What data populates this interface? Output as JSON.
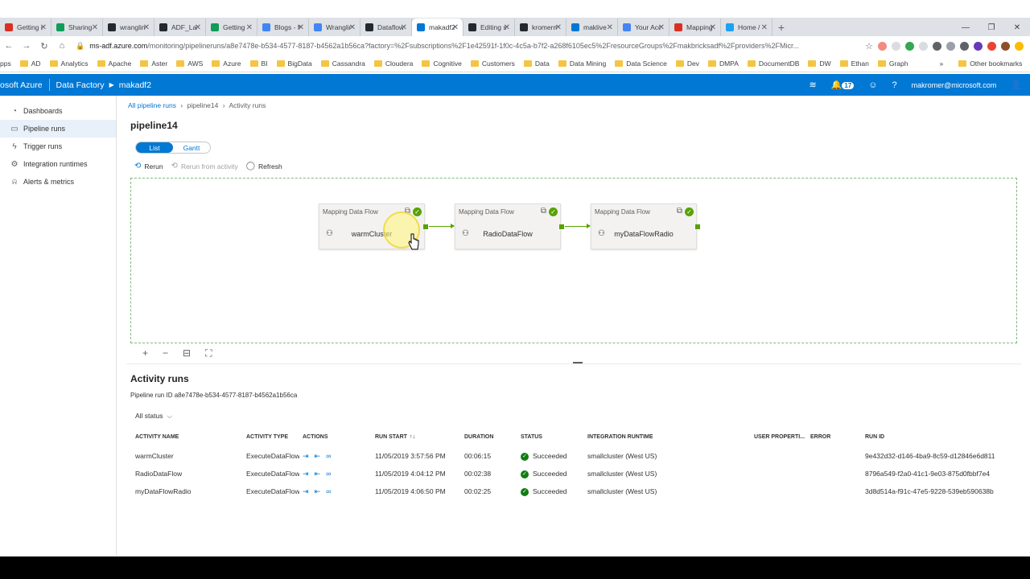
{
  "browser": {
    "tabs": [
      {
        "label": "Getting s",
        "color": "#d93025",
        "active": false
      },
      {
        "label": "Sharing",
        "color": "#0f9d58",
        "active": false
      },
      {
        "label": "wranglin",
        "color": "#24292e",
        "active": false
      },
      {
        "label": "ADF_Lab",
        "color": "#24292e",
        "active": false
      },
      {
        "label": "Getting",
        "color": "#0f9d58",
        "active": false
      },
      {
        "label": "Blogs - M",
        "color": "#4285f4",
        "active": false
      },
      {
        "label": "Wranglin",
        "color": "#4285f4",
        "active": false
      },
      {
        "label": "Dataflow",
        "color": "#24292e",
        "active": false
      },
      {
        "label": "makadf2",
        "color": "#0078d4",
        "active": true
      },
      {
        "label": "Editing s",
        "color": "#24292e",
        "active": false
      },
      {
        "label": "kromerm",
        "color": "#24292e",
        "active": false
      },
      {
        "label": "maklive",
        "color": "#0078d4",
        "active": false
      },
      {
        "label": "Your Acc",
        "color": "#4285f4",
        "active": false
      },
      {
        "label": "Mapping",
        "color": "#d93025",
        "active": false
      },
      {
        "label": "Home /",
        "color": "#1da1f2",
        "active": false
      }
    ],
    "new_tab": "+",
    "url_host": "ms-adf.azure.com",
    "url_path": "/monitoring/pipelineruns/a8e7478e-b534-4577-8187-b4562a1b56ca?factory=%2Fsubscriptions%2F1e42591f-1f0c-4c5a-b7f2-a268f6105ec5%2FresourceGroups%2Fmakbricksadf%2Fproviders%2FMicr...",
    "bookmarks": [
      "pps",
      "AD",
      "Analytics",
      "Apache",
      "Aster",
      "AWS",
      "Azure",
      "BI",
      "BigData",
      "Cassandra",
      "Cloudera",
      "Cognitive",
      "Customers",
      "Data",
      "Data Mining",
      "Data Science",
      "Dev",
      "DMPA",
      "DocumentDB",
      "DW",
      "Ethan",
      "Graph"
    ],
    "bookmarks_more": "»",
    "other_bookmarks": "Other bookmarks"
  },
  "header": {
    "brand": "osoft Azure",
    "product": "Data Factory",
    "factory": "makadf2",
    "notification_count": "17",
    "user": "makromer@microsoft.com"
  },
  "sidebar": {
    "items": [
      {
        "label": "Dashboards",
        "icon": "◔",
        "active": false
      },
      {
        "label": "Pipeline runs",
        "icon": "▭",
        "active": true
      },
      {
        "label": "Trigger runs",
        "icon": "ϟ",
        "active": false
      },
      {
        "label": "Integration runtimes",
        "icon": "⚙",
        "active": false
      },
      {
        "label": "Alerts & metrics",
        "icon": "⍾",
        "active": false
      }
    ]
  },
  "breadcrumb": {
    "root": "All pipeline runs",
    "sep": "›",
    "current": "pipeline14",
    "sep2": "›",
    "leaf": "Activity runs"
  },
  "page_title": "pipeline14",
  "view_toggle": {
    "list": "List",
    "gantt": "Gantt"
  },
  "toolbar": {
    "rerun": "Rerun",
    "rerun_from": "Rerun from activity",
    "refresh": "Refresh"
  },
  "nodes": [
    {
      "type": "Mapping Data Flow",
      "name": "warmCluster"
    },
    {
      "type": "Mapping Data Flow",
      "name": "RadioDataFlow"
    },
    {
      "type": "Mapping Data Flow",
      "name": "myDataFlowRadio"
    }
  ],
  "activity_runs": {
    "title": "Activity runs",
    "run_id_label": "Pipeline run ID",
    "run_id": "a8e7478e-b534-4577-8187-b4562a1b56ca",
    "filter": "All status",
    "columns": [
      "ACTIVITY NAME",
      "ACTIVITY TYPE",
      "ACTIONS",
      "RUN START",
      "DURATION",
      "STATUS",
      "INTEGRATION RUNTIME",
      "USER PROPERTI...",
      "ERROR",
      "RUN ID"
    ],
    "sort_icon": "↑↓",
    "rows": [
      {
        "name": "warmCluster",
        "type": "ExecuteDataFlow",
        "start": "11/05/2019 3:57:56 PM",
        "duration": "00:06:15",
        "status": "Succeeded",
        "runtime": "smallcluster (West US)",
        "run_id": "9e432d32-d146-4ba9-8c59-d12846e6d811"
      },
      {
        "name": "RadioDataFlow",
        "type": "ExecuteDataFlow",
        "start": "11/05/2019 4:04:12 PM",
        "duration": "00:02:38",
        "status": "Succeeded",
        "runtime": "smallcluster (West US)",
        "run_id": "8796a549-f2a0-41c1-9e03-875d0fbbf7e4"
      },
      {
        "name": "myDataFlowRadio",
        "type": "ExecuteDataFlow",
        "start": "11/05/2019 4:06:50 PM",
        "duration": "00:02:25",
        "status": "Succeeded",
        "runtime": "smallcluster (West US)",
        "run_id": "3d8d514a-f91c-47e5-9228-539eb590638b"
      }
    ]
  },
  "colors": {
    "accent": "#0078d4",
    "success": "#57a300"
  }
}
